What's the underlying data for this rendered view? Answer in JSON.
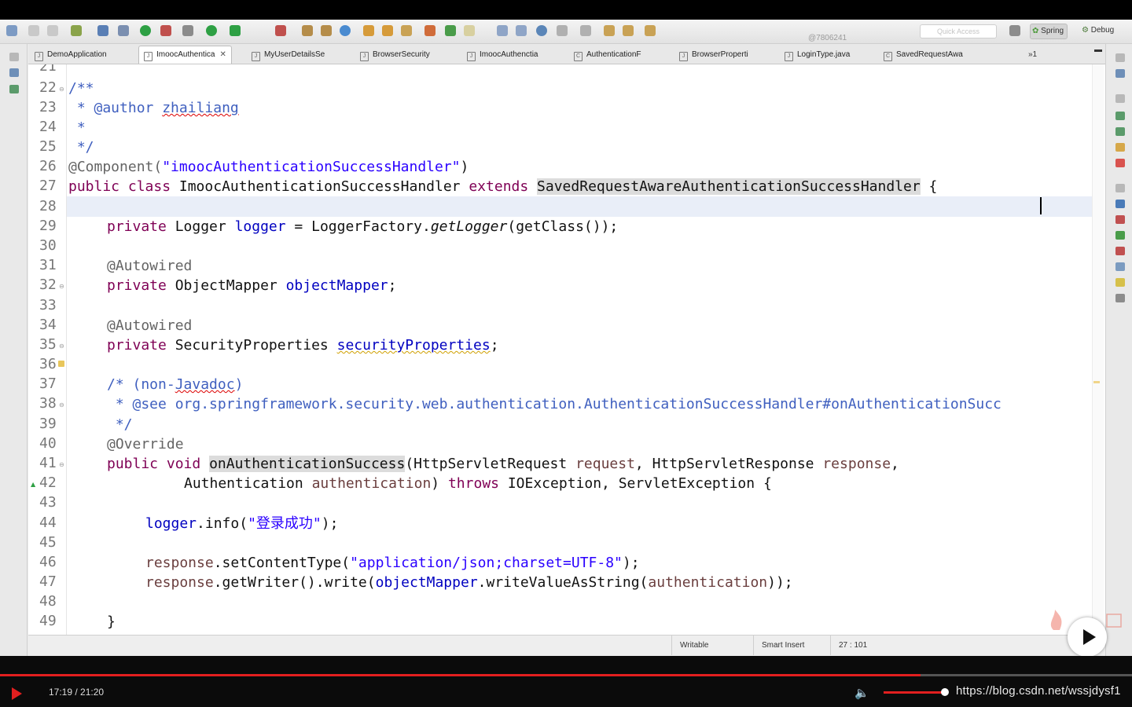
{
  "toolbar": {
    "watermark_id": "@7806241",
    "quick_access_placeholder": "Quick Access",
    "perspectives": [
      "Spring",
      "Debug"
    ]
  },
  "tabs": [
    {
      "label": "DemoApplication",
      "active": false
    },
    {
      "label": "ImoocAuthentica",
      "active": true,
      "close": "✕"
    },
    {
      "label": "MyUserDetailsSe",
      "active": false
    },
    {
      "label": "BrowserSecurity",
      "active": false
    },
    {
      "label": "ImoocAuthenctia",
      "active": false
    },
    {
      "label": "AuthenticationF",
      "active": false
    },
    {
      "label": "BrowserProperti",
      "active": false
    },
    {
      "label": "LoginType.java",
      "active": false
    },
    {
      "label": "SavedRequestAwa",
      "active": false
    }
  ],
  "tab_overflow": "»1",
  "editor": {
    "line_numbers": [
      "21",
      "22",
      "23",
      "24",
      "25",
      "26",
      "27",
      "28",
      "29",
      "30",
      "31",
      "32",
      "33",
      "34",
      "35",
      "36",
      "37",
      "38",
      "39",
      "40",
      "41",
      "42",
      "43",
      "44",
      "45",
      "46",
      "47",
      "48",
      "49"
    ],
    "lines": {
      "l22": "/**",
      "l23a": " * @author ",
      "l23b": "zhailiang",
      "l24": " *",
      "l25": " */",
      "l26a": "@Component(",
      "l26b": "\"imoocAuthenticationSuccessHandler\"",
      "l26c": ")",
      "l27a": "public class",
      "l27b": " ImoocAuthenticationSuccessHandler ",
      "l27c": "extends",
      "l27d": " ",
      "l27e": "SavedRequestAwareAuthenticationSuccessHandler",
      "l27f": " {",
      "l29a": "private",
      "l29b": " Logger ",
      "l29c": "logger",
      "l29d": " = LoggerFactory.",
      "l29e": "getLogger",
      "l29f": "(getClass());",
      "l31": "@Autowired",
      "l32a": "private",
      "l32b": " ObjectMapper ",
      "l32c": "objectMapper",
      "l32d": ";",
      "l34": "@Autowired",
      "l35a": "private",
      "l35b": " SecurityProperties ",
      "l35c": "securityProperties",
      "l35d": ";",
      "l37a": "/* (non-",
      "l37b": "Javadoc",
      "l37c": ")",
      "l38": " * @see org.springframework.security.web.authentication.AuthenticationSuccessHandler#onAuthenticationSucc",
      "l39": " */",
      "l40": "@Override",
      "l41a": "public void",
      "l41b": " ",
      "l41c": "onAuthenticationSuccess",
      "l41d": "(HttpServletRequest ",
      "l41e": "request",
      "l41f": ", HttpServletResponse ",
      "l41g": "response",
      "l41h": ",",
      "l42a": "Authentication ",
      "l42b": "authentication",
      "l42c": ") ",
      "l42d": "throws",
      "l42e": " IOException, ServletException {",
      "l44a": "logger",
      "l44b": ".info(",
      "l44c": "\"登录成功\"",
      "l44d": ");",
      "l46a": "response",
      "l46b": ".setContentType(",
      "l46c": "\"application/json;charset=UTF-8\"",
      "l46d": ");",
      "l47a": "response",
      "l47b": ".getWriter().write(",
      "l47c": "objectMapper",
      "l47d": ".writeValueAsString(",
      "l47e": "authentication",
      "l47f": "));",
      "l49": "}"
    }
  },
  "status": {
    "writable": "Writable",
    "insert_mode": "Smart Insert",
    "position": "27 : 101"
  },
  "video": {
    "time": "17:19 / 21:20",
    "progress": 0.8131,
    "buffered": 0.81,
    "volume": 0.95,
    "watermark": "https://blog.csdn.net/wssjdysf1",
    "accent": "#e21f1f"
  }
}
